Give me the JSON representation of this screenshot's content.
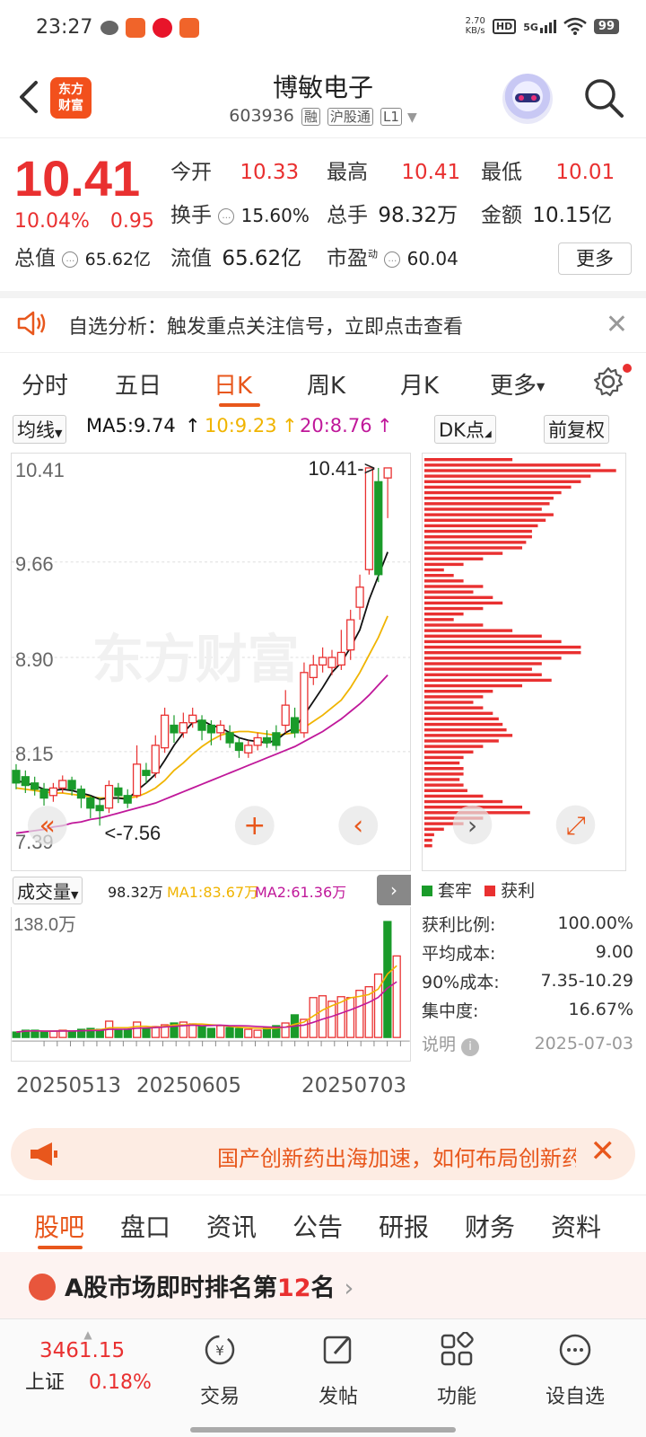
{
  "status_bar": {
    "time": "23:27",
    "network_speed_top": "2.70",
    "network_speed_bottom": "KB/s",
    "hd_label": "HD",
    "signal_label": "5G",
    "battery": "99"
  },
  "header": {
    "logo_line1": "东方",
    "logo_line2": "财富",
    "stock_name": "博敏电子",
    "stock_code": "603936",
    "tags": [
      "融",
      "沪股通",
      "L1"
    ]
  },
  "quote": {
    "price": "10.41",
    "change_pct": "10.04%",
    "change_amt": "0.95",
    "open_label": "今开",
    "open": "10.33",
    "high_label": "最高",
    "high": "10.41",
    "low_label": "最低",
    "low": "10.01",
    "turnover_label": "换手",
    "turnover": "15.60%",
    "volume_label": "总手",
    "volume": "98.32万",
    "amount_label": "金额",
    "amount": "10.15亿",
    "mktcap_label": "总值",
    "mktcap": "65.62亿",
    "float_label": "流值",
    "float_cap": "65.62亿",
    "pe_label": "市盈",
    "pe_superscript": "动",
    "pe": "60.04",
    "more_button": "更多"
  },
  "notice": {
    "text": "自选分析：触发重点关注信号，立即点击查看"
  },
  "period_tabs": [
    "分时",
    "五日",
    "日K",
    "周K",
    "月K",
    "更多"
  ],
  "ma_row": {
    "indicator": "均线",
    "ma5": "MA5:9.74",
    "ma10": "10:9.23",
    "ma20": "20:8.76",
    "dk_button": "DK点",
    "adjust_button": "前复权"
  },
  "kchart": {
    "y_ticks": [
      "10.41",
      "9.66",
      "8.90",
      "8.15",
      "7.39"
    ],
    "max_label": "10.41->",
    "min_label": "<-7.56",
    "candles": [
      {
        "o": 8.0,
        "c": 7.9,
        "h": 8.05,
        "l": 7.85
      },
      {
        "o": 7.95,
        "c": 7.88,
        "h": 8.0,
        "l": 7.82
      },
      {
        "o": 7.9,
        "c": 7.85,
        "h": 7.95,
        "l": 7.8
      },
      {
        "o": 7.85,
        "c": 7.78,
        "h": 7.9,
        "l": 7.72
      },
      {
        "o": 7.8,
        "c": 7.86,
        "h": 7.9,
        "l": 7.75
      },
      {
        "o": 7.86,
        "c": 7.92,
        "h": 7.96,
        "l": 7.82
      },
      {
        "o": 7.92,
        "c": 7.85,
        "h": 7.95,
        "l": 7.8
      },
      {
        "o": 7.85,
        "c": 7.78,
        "h": 7.88,
        "l": 7.7
      },
      {
        "o": 7.78,
        "c": 7.7,
        "h": 7.8,
        "l": 7.62
      },
      {
        "o": 7.72,
        "c": 7.68,
        "h": 7.78,
        "l": 7.56
      },
      {
        "o": 7.7,
        "c": 7.88,
        "h": 7.92,
        "l": 7.66
      },
      {
        "o": 7.86,
        "c": 7.8,
        "h": 7.9,
        "l": 7.74
      },
      {
        "o": 7.8,
        "c": 7.74,
        "h": 7.85,
        "l": 7.7
      },
      {
        "o": 7.8,
        "c": 8.05,
        "h": 8.2,
        "l": 7.78
      },
      {
        "o": 8.0,
        "c": 7.96,
        "h": 8.06,
        "l": 7.9
      },
      {
        "o": 7.98,
        "c": 8.2,
        "h": 8.28,
        "l": 7.94
      },
      {
        "o": 8.18,
        "c": 8.44,
        "h": 8.5,
        "l": 8.14
      },
      {
        "o": 8.36,
        "c": 8.3,
        "h": 8.44,
        "l": 8.22
      },
      {
        "o": 8.3,
        "c": 8.38,
        "h": 8.46,
        "l": 8.26
      },
      {
        "o": 8.38,
        "c": 8.44,
        "h": 8.5,
        "l": 8.34
      },
      {
        "o": 8.4,
        "c": 8.32,
        "h": 8.44,
        "l": 8.24
      },
      {
        "o": 8.36,
        "c": 8.3,
        "h": 8.4,
        "l": 8.2
      },
      {
        "o": 8.3,
        "c": 8.36,
        "h": 8.4,
        "l": 8.24
      },
      {
        "o": 8.3,
        "c": 8.22,
        "h": 8.36,
        "l": 8.18
      },
      {
        "o": 8.22,
        "c": 8.16,
        "h": 8.26,
        "l": 8.1
      },
      {
        "o": 8.14,
        "c": 8.2,
        "h": 8.24,
        "l": 8.1
      },
      {
        "o": 8.2,
        "c": 8.26,
        "h": 8.3,
        "l": 8.16
      },
      {
        "o": 8.26,
        "c": 8.22,
        "h": 8.32,
        "l": 8.18
      },
      {
        "o": 8.3,
        "c": 8.2,
        "h": 8.36,
        "l": 8.16
      },
      {
        "o": 8.36,
        "c": 8.52,
        "h": 8.64,
        "l": 8.3
      },
      {
        "o": 8.42,
        "c": 8.3,
        "h": 8.5,
        "l": 8.26
      },
      {
        "o": 8.3,
        "c": 8.78,
        "h": 8.86,
        "l": 8.26
      },
      {
        "o": 8.74,
        "c": 8.84,
        "h": 8.92,
        "l": 8.68
      },
      {
        "o": 8.84,
        "c": 8.9,
        "h": 8.98,
        "l": 8.78
      },
      {
        "o": 8.82,
        "c": 8.9,
        "h": 8.96,
        "l": 8.76
      },
      {
        "o": 8.84,
        "c": 8.94,
        "h": 9.12,
        "l": 8.8
      },
      {
        "o": 8.96,
        "c": 9.2,
        "h": 9.28,
        "l": 8.88
      },
      {
        "o": 9.3,
        "c": 9.46,
        "h": 9.56,
        "l": 9.2
      },
      {
        "o": 9.6,
        "c": 10.41,
        "h": 10.41,
        "l": 9.56
      },
      {
        "o": 10.3,
        "c": 9.56,
        "h": 10.41,
        "l": 9.5
      },
      {
        "o": 10.33,
        "c": 10.41,
        "h": 10.41,
        "l": 10.01
      }
    ],
    "ma5": [
      7.92,
      7.9,
      7.88,
      7.85,
      7.84,
      7.85,
      7.84,
      7.82,
      7.8,
      7.77,
      7.78,
      7.78,
      7.77,
      7.84,
      7.9,
      7.97,
      8.08,
      8.2,
      8.3,
      8.38,
      8.4,
      8.36,
      8.34,
      8.3,
      8.26,
      8.24,
      8.23,
      8.22,
      8.24,
      8.3,
      8.34,
      8.44,
      8.55,
      8.66,
      8.78,
      8.86,
      8.98,
      9.12,
      9.36,
      9.55,
      9.74
    ],
    "ma10": [
      7.86,
      7.85,
      7.84,
      7.83,
      7.82,
      7.82,
      7.81,
      7.8,
      7.79,
      7.78,
      7.78,
      7.78,
      7.78,
      7.79,
      7.82,
      7.86,
      7.92,
      8.0,
      8.06,
      8.13,
      8.19,
      8.24,
      8.28,
      8.3,
      8.31,
      8.31,
      8.3,
      8.29,
      8.28,
      8.29,
      8.3,
      8.34,
      8.39,
      8.44,
      8.5,
      8.56,
      8.66,
      8.78,
      8.92,
      9.06,
      9.23
    ],
    "ma20": [
      7.5,
      7.51,
      7.52,
      7.53,
      7.55,
      7.56,
      7.58,
      7.59,
      7.61,
      7.62,
      7.64,
      7.66,
      7.68,
      7.7,
      7.72,
      7.74,
      7.77,
      7.8,
      7.83,
      7.86,
      7.89,
      7.92,
      7.95,
      7.98,
      8.01,
      8.04,
      8.07,
      8.1,
      8.13,
      8.16,
      8.19,
      8.23,
      8.27,
      8.31,
      8.36,
      8.41,
      8.47,
      8.53,
      8.6,
      8.68,
      8.76
    ]
  },
  "profile": {
    "bars": [
      0.45,
      0.9,
      0.98,
      0.85,
      0.8,
      0.75,
      0.7,
      0.66,
      0.64,
      0.6,
      0.66,
      0.62,
      0.58,
      0.55,
      0.55,
      0.52,
      0.5,
      0.4,
      0.3,
      0.2,
      0.1,
      0.15,
      0.2,
      0.3,
      0.25,
      0.35,
      0.4,
      0.3,
      0.2,
      0.15,
      0.3,
      0.45,
      0.6,
      0.7,
      0.8,
      0.8,
      0.7,
      0.6,
      0.55,
      0.6,
      0.65,
      0.5,
      0.35,
      0.3,
      0.25,
      0.3,
      0.35,
      0.38,
      0.4,
      0.42,
      0.45,
      0.38,
      0.3,
      0.25,
      0.2,
      0.18,
      0.2,
      0.2,
      0.18,
      0.2,
      0.22,
      0.3,
      0.4,
      0.5,
      0.54,
      0.3,
      0.2,
      0.1,
      0.05,
      0.04,
      0.04
    ]
  },
  "volume": {
    "label": "成交量",
    "vol": "98.32万",
    "ma1": "MA1:83.67万",
    "ma2": "MA2:61.36万",
    "y_max_label": "138.0万",
    "bars": [
      6,
      8,
      8,
      6,
      7,
      8,
      7,
      9,
      10,
      9,
      18,
      8,
      9,
      17,
      10,
      12,
      14,
      16,
      17,
      15,
      12,
      10,
      13,
      11,
      10,
      9,
      8,
      11,
      13,
      16,
      25,
      20,
      44,
      46,
      40,
      45,
      44,
      52,
      56,
      70,
      128,
      90
    ],
    "up": [
      false,
      false,
      false,
      false,
      true,
      true,
      false,
      false,
      false,
      false,
      true,
      false,
      false,
      true,
      false,
      true,
      true,
      false,
      true,
      true,
      false,
      false,
      true,
      false,
      false,
      true,
      true,
      false,
      false,
      true,
      false,
      true,
      true,
      true,
      true,
      true,
      true,
      true,
      true,
      true,
      false,
      true
    ]
  },
  "date_labels": [
    "20250513",
    "20250605",
    "20250703"
  ],
  "chip_stats": {
    "legend_trapped": "套牢",
    "legend_profit": "获利",
    "profit_ratio_label": "获利比例:",
    "profit_ratio": "100.00%",
    "avg_cost_label": "平均成本:",
    "avg_cost": "9.00",
    "cost90_label": "90%成本:",
    "cost90": "7.35-10.29",
    "concentration_label": "集中度:",
    "concentration": "16.67%",
    "explain_label": "说明",
    "date": "2025-07-03"
  },
  "banner": {
    "text": "国产创新药出海加速，如何布局创新药"
  },
  "content_tabs": [
    "股吧",
    "盘口",
    "资讯",
    "公告",
    "研报",
    "财务",
    "资料"
  ],
  "rank": {
    "prefix": "A股市场即时排名第",
    "number": "12",
    "suffix": "名"
  },
  "bottom_nav": {
    "index_value": "3461.15",
    "index_name": "上证",
    "index_change": "0.18%",
    "items": [
      "交易",
      "发帖",
      "功能",
      "设自选"
    ]
  },
  "colors": {
    "up_red": "#e93030",
    "down_green": "#1a9b2a",
    "accent_orange": "#e8571c",
    "ma5_black": "#111111",
    "ma10_yellow": "#f0b400",
    "ma20_magenta": "#c0189a"
  }
}
